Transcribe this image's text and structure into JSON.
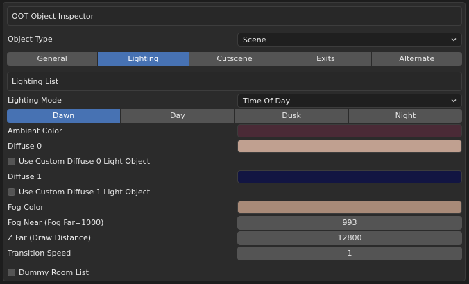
{
  "inspector": {
    "title": "OOT Object Inspector"
  },
  "object_type": {
    "label": "Object Type",
    "value": "Scene"
  },
  "main_tabs": [
    {
      "label": "General",
      "active": false
    },
    {
      "label": "Lighting",
      "active": true
    },
    {
      "label": "Cutscene",
      "active": false
    },
    {
      "label": "Exits",
      "active": false
    },
    {
      "label": "Alternate",
      "active": false
    }
  ],
  "lighting_list": {
    "title": "Lighting List"
  },
  "lighting_mode": {
    "label": "Lighting Mode",
    "value": "Time Of Day"
  },
  "time_tabs": [
    {
      "label": "Dawn",
      "active": true
    },
    {
      "label": "Day",
      "active": false
    },
    {
      "label": "Dusk",
      "active": false
    },
    {
      "label": "Night",
      "active": false
    }
  ],
  "ambient": {
    "label": "Ambient Color",
    "color": "#4a2a36"
  },
  "diffuse0": {
    "label": "Diffuse 0",
    "color": "#c0a090",
    "custom_label": "Use Custom Diffuse 0 Light Object"
  },
  "diffuse1": {
    "label": "Diffuse 1",
    "color": "#121542",
    "custom_label": "Use Custom Diffuse 1 Light Object"
  },
  "fog": {
    "label": "Fog Color",
    "color": "#a88a78"
  },
  "fog_near": {
    "label": "Fog Near (Fog Far=1000)",
    "value": "993"
  },
  "z_far": {
    "label": "Z Far (Draw Distance)",
    "value": "12800"
  },
  "transition_speed": {
    "label": "Transition Speed",
    "value": "1"
  },
  "dummy_room": {
    "label": "Dummy Room List"
  },
  "icons": {
    "dropdown": "chevron-down-icon"
  }
}
